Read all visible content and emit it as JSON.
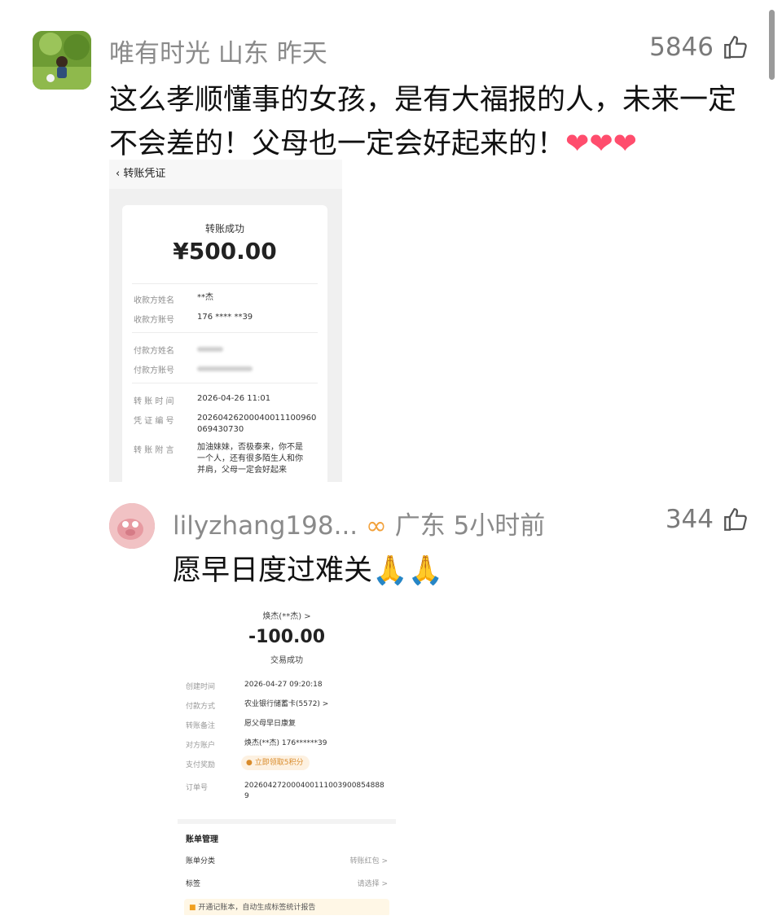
{
  "comments": [
    {
      "username": "唯有时光",
      "location": "山东",
      "time": "昨天",
      "likes": "5846",
      "text_line1": "这么孝顺懂事的女孩，是有大福报的人，未来一定",
      "text_line2": "不会差的！父母也一定会好起来的！",
      "emoji": "❤❤❤",
      "screenshot": {
        "header": "转账凭证",
        "back_icon": "chevron-left-icon",
        "status": "转账成功",
        "amount": "¥500.00",
        "rows": [
          {
            "label": "收款方姓名",
            "value": "**杰"
          },
          {
            "label": "收款方账号",
            "value": "176 **** **39"
          },
          {
            "label": "付款方姓名",
            "value": ""
          },
          {
            "label": "付款方账号",
            "value": ""
          },
          {
            "label": "转 账 时 间",
            "value": "2026-04-26 11:01"
          },
          {
            "label": "凭 证 编 号",
            "value": "20260426200040011100960\n069430730"
          },
          {
            "label": "转 账 附 言",
            "value": "加油妹妹，否极泰来，你不是\n一个人，还有很多陌生人和你\n并肩，父母一定会好起来"
          }
        ]
      }
    },
    {
      "username": "lilyzhang198...",
      "badge_icon": "infinity-badge-icon",
      "location": "广东",
      "time": "5小时前",
      "likes": "344",
      "text": "愿早日度过难关",
      "emoji": "🙏🙏",
      "screenshot": {
        "payee": "焕杰(**杰) >",
        "amount": "-100.00",
        "status": "交易成功",
        "rows": [
          {
            "label": "创建时间",
            "value": "2026-04-27 09:20:18"
          },
          {
            "label": "付款方式",
            "value": "农业银行储蓄卡(5572) >"
          },
          {
            "label": "转账备注",
            "value": "愿父母早日康复"
          },
          {
            "label": "对方账户",
            "value": "焕杰(**杰) 176******39"
          },
          {
            "label": "支付奖励",
            "value": "立即领取5积分"
          },
          {
            "label": "订单号",
            "value": "202604272000400111003900854888\n9"
          }
        ],
        "management": {
          "title": "账单管理",
          "category_label": "账单分类",
          "category_value": "转账红包 >",
          "tag_label": "标签",
          "tag_value": "请选择 >",
          "promo": "开通记账本，自动生成标签统计报告"
        }
      }
    }
  ]
}
